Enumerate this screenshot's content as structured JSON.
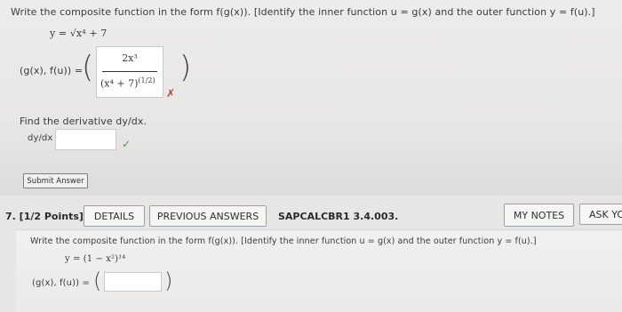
{
  "q6": {
    "instruction": "Write the composite function in the form f(g(x)). [Identify the inner function u = g(x) and the outer function y = f(u).]",
    "given_function": "y = √x⁴ + 7",
    "pair_label": "(g(x), f(u)) =",
    "fraction_numerator": "2x³",
    "fraction_denominator": "(x⁴ + 7)^(1/2)",
    "fraction_denominator_base": "(x⁴ + 7)",
    "fraction_denominator_exponent": "(1/2)",
    "incorrect_mark": "✗",
    "derivative_prompt": "Find the derivative dy/dx.",
    "derivative_label": "dy/dx =",
    "dy_input_value": "",
    "correct_mark": "✓",
    "submit_label": "Submit Answer"
  },
  "q7": {
    "number_label": "7. [1/2 Points]",
    "details_label": "DETAILS",
    "previous_answers_label": "PREVIOUS ANSWERS",
    "course_code": "SAPCALCBR1 3.4.003.",
    "my_notes_label": "MY NOTES",
    "ask_label": "ASK YO",
    "instruction": "Write the composite function in the form f(g(x)). [Identify the inner function u = g(x) and the outer function y = f(u).]",
    "given_function": "y = (1 − x²)¹⁴",
    "pair_label": "(g(x), f(u)) =",
    "pair_input_value": ""
  },
  "colors": {
    "incorrect": "#c0392b",
    "correct": "#4a9a3a",
    "button_border": "#9aa0a6"
  },
  "icons": [
    "incorrect-x-icon",
    "correct-check-icon"
  ]
}
